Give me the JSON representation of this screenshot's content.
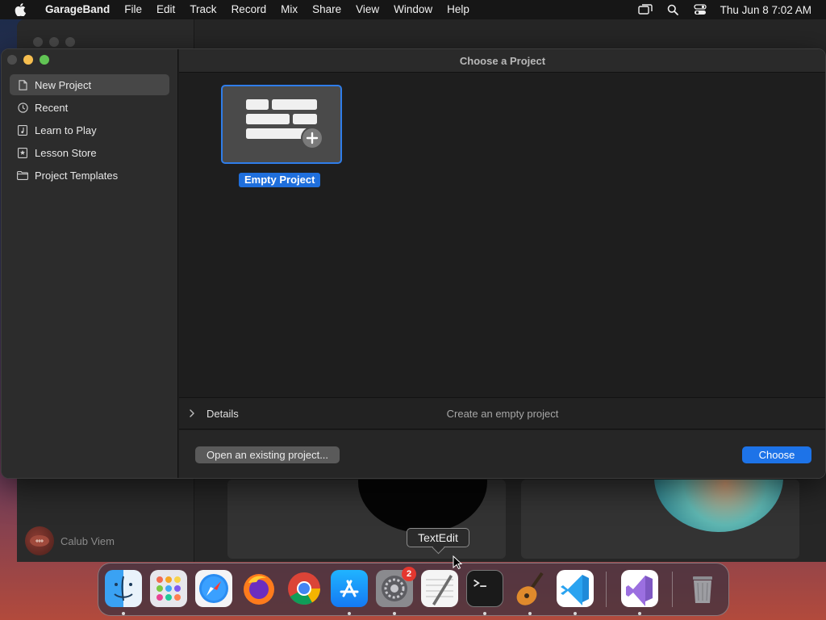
{
  "menubar": {
    "app_name": "GarageBand",
    "menus": [
      "File",
      "Edit",
      "Track",
      "Record",
      "Mix",
      "Share",
      "View",
      "Window",
      "Help"
    ],
    "status_icons": [
      "screen-mirroring-icon",
      "spotlight-search-icon",
      "control-center-icon"
    ],
    "clock": "Thu Jun 8  7:02 AM"
  },
  "background_window": {
    "user_name": "Calub Viem"
  },
  "dialog": {
    "title": "Choose a Project",
    "sidebar": {
      "items": [
        {
          "label": "New Project",
          "icon": "document-icon",
          "selected": true
        },
        {
          "label": "Recent",
          "icon": "clock-icon",
          "selected": false
        },
        {
          "label": "Learn to Play",
          "icon": "music-note-icon",
          "selected": false
        },
        {
          "label": "Lesson Store",
          "icon": "star-icon",
          "selected": false
        },
        {
          "label": "Project Templates",
          "icon": "folder-icon",
          "selected": false
        }
      ]
    },
    "project": {
      "label": "Empty Project",
      "selected": true
    },
    "details": {
      "label": "Details",
      "description": "Create an empty project"
    },
    "buttons": {
      "open_existing": "Open an existing project...",
      "choose": "Choose"
    },
    "colors": {
      "accent": "#1d73e8",
      "selection_border": "#2f7de9"
    }
  },
  "tooltip": {
    "text": "TextEdit"
  },
  "dock": {
    "apps": [
      {
        "name": "Finder",
        "icon": "finder-icon",
        "running": true
      },
      {
        "name": "Launchpad",
        "icon": "launchpad-icon",
        "running": false
      },
      {
        "name": "Safari",
        "icon": "safari-icon",
        "running": false
      },
      {
        "name": "Firefox",
        "icon": "firefox-icon",
        "running": false
      },
      {
        "name": "Chrome",
        "icon": "chrome-icon",
        "running": false
      },
      {
        "name": "App Store",
        "icon": "app-store-icon",
        "running": true
      },
      {
        "name": "System Settings",
        "icon": "system-settings-icon",
        "running": true,
        "badge": "2"
      },
      {
        "name": "TextEdit",
        "icon": "textedit-icon",
        "running": false
      },
      {
        "name": "Terminal",
        "icon": "terminal-icon",
        "running": true
      },
      {
        "name": "GarageBand",
        "icon": "garageband-icon",
        "running": true
      },
      {
        "name": "Visual Studio Code",
        "icon": "vscode-icon",
        "running": true
      },
      {
        "name": "Visual Studio",
        "icon": "visual-studio-icon",
        "running": true
      },
      {
        "name": "Trash",
        "icon": "trash-icon",
        "running": false
      }
    ]
  }
}
